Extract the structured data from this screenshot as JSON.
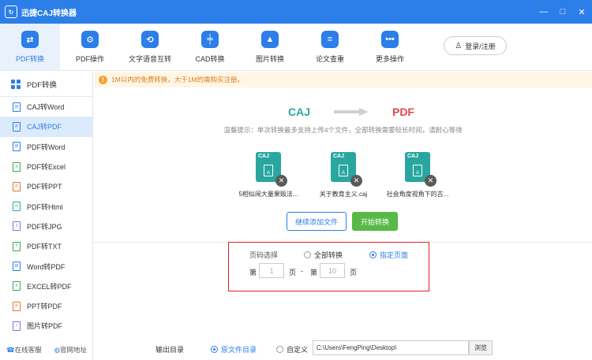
{
  "window": {
    "title": "迅捷CAJ转换器",
    "min": "—",
    "max": "□",
    "close": "✕"
  },
  "toolbar": {
    "items": [
      {
        "label": "PDF转换",
        "icon": "convert-icon",
        "glyph": "⇄"
      },
      {
        "label": "PDF操作",
        "icon": "gear-icon",
        "glyph": "⚙"
      },
      {
        "label": "文字语音互转",
        "icon": "voice-icon",
        "glyph": "⟲"
      },
      {
        "label": "CAD转换",
        "icon": "cad-icon",
        "glyph": "╪"
      },
      {
        "label": "图片转换",
        "icon": "image-icon",
        "glyph": "▲"
      },
      {
        "label": "论文查重",
        "icon": "check-icon",
        "glyph": "≡"
      },
      {
        "label": "更多操作",
        "icon": "more-icon",
        "glyph": "•••"
      }
    ],
    "login": "登录/注册"
  },
  "sidebar": {
    "header": "PDF转换",
    "items": [
      {
        "label": "CAJ转Word",
        "color": "#2c7ee8",
        "tag": "W"
      },
      {
        "label": "CAJ转PDF",
        "color": "#2c7ee8",
        "tag": "P"
      },
      {
        "label": "PDF转Word",
        "color": "#2c7ee8",
        "tag": "W"
      },
      {
        "label": "PDF转Excel",
        "color": "#3aa55a",
        "tag": "X"
      },
      {
        "label": "PDF转PPT",
        "color": "#e8742c",
        "tag": "P"
      },
      {
        "label": "PDF转Html",
        "color": "#2aa6a0",
        "tag": "H"
      },
      {
        "label": "PDF转JPG",
        "color": "#7a7ad8",
        "tag": "J"
      },
      {
        "label": "PDF转TXT",
        "color": "#3aa55a",
        "tag": "T"
      },
      {
        "label": "Word转PDF",
        "color": "#2c7ee8",
        "tag": "W"
      },
      {
        "label": "EXCEL转PDF",
        "color": "#3aa55a",
        "tag": "X"
      },
      {
        "label": "PPT转PDF",
        "color": "#e8742c",
        "tag": "P"
      },
      {
        "label": "图片转PDF",
        "color": "#7a7ad8",
        "tag": "I"
      }
    ],
    "footer": {
      "service": "在线客服",
      "website": "官网地址"
    }
  },
  "notice": "1M以内的免费转换，大于1M的需购买注册。",
  "convert": {
    "from": "CAJ",
    "to": "PDF",
    "hint": "温馨提示：单次转换最多支持上传4个文件，全部转换需要较长时间，请耐心等待",
    "files": [
      {
        "name": "5相似阅大量果贩法...",
        "tag": "CAJ"
      },
      {
        "name": "关于教育主义.caj",
        "tag": "CAJ"
      },
      {
        "name": "社会角度视角下的古...",
        "tag": "CAJ"
      }
    ],
    "add_button": "继续添加文件",
    "start_button": "开始转换"
  },
  "page_select": {
    "label": "页码选择",
    "option_all": "全部转换",
    "option_range": "指定页面",
    "selected": "指定页面",
    "from_prefix": "第",
    "from_value": "1",
    "from_suffix": "页",
    "separator": "-",
    "to_prefix": "第",
    "to_value": "10",
    "to_suffix": "页"
  },
  "output": {
    "label": "输出目录",
    "option_source": "原文件目录",
    "option_custom": "自定义",
    "selected": "原文件目录",
    "path": "C:\\Users\\FengPing\\Desktop\\",
    "browse": "浏览"
  }
}
